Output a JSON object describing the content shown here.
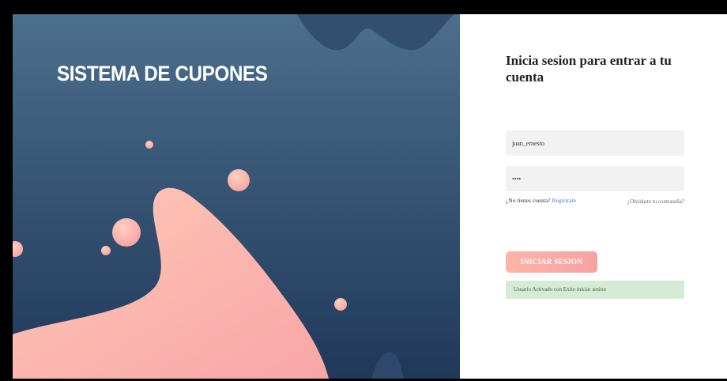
{
  "brand": {
    "title": "SISTEMA DE CUPONES"
  },
  "login": {
    "heading": "Inicia sesion para entrar a tu cuenta",
    "username_value": "juan_ernesto",
    "password_value": "••••",
    "no_account_text": "¿No tienes cuenta?",
    "register_link": "Registrate",
    "forgot_link": "¿Olvidaste tu contraseña?",
    "submit_label": "INICIAR SESION",
    "alert_message": "Usuario Activado con Exito iniciar sesion"
  },
  "colors": {
    "left_panel_top": "#4d6f8e",
    "left_panel_bottom": "#20385a",
    "blob_pink": "#fbc3b6",
    "button_pink": "#f7a2a2",
    "alert_green": "#d6ebd6"
  },
  "decor": {
    "shapes": [
      "pink-wave-blob",
      "pink-bubbles",
      "dark-blue-blob"
    ]
  }
}
